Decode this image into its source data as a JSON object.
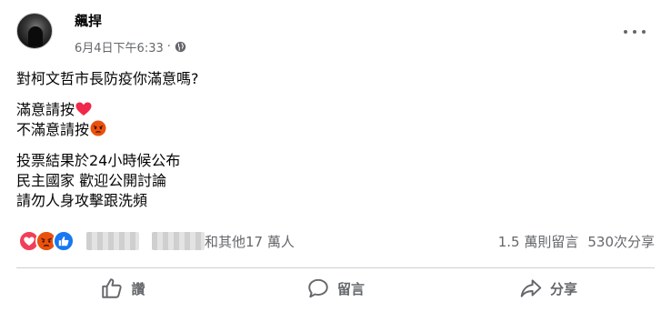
{
  "post": {
    "author": "飆捍",
    "timestamp": "6月4日下午6:33",
    "separator": "·",
    "privacy_icon": "globe-icon",
    "lines": {
      "question": "對柯文哲市長防疫你滿意嗎?",
      "satisfied": "滿意請按",
      "unsatisfied": "不滿意請按",
      "result": "投票結果於24小時候公布",
      "democracy": "民主國家 歡迎公開討論",
      "no_attack": "請勿人身攻擊跟洗頻"
    }
  },
  "reactions": {
    "icons": [
      "heart-icon",
      "angry-icon",
      "like-icon"
    ],
    "others_text": "和其他17 萬人",
    "comments": "1.5 萬則留言",
    "shares": "530次分享"
  },
  "actions": {
    "like": "讚",
    "comment": "留言",
    "share": "分享"
  },
  "colors": {
    "secondary_text": "#65676b",
    "like_blue": "#1877f2",
    "love_red": "#f33e58",
    "angry_orange": "#e9710f"
  }
}
